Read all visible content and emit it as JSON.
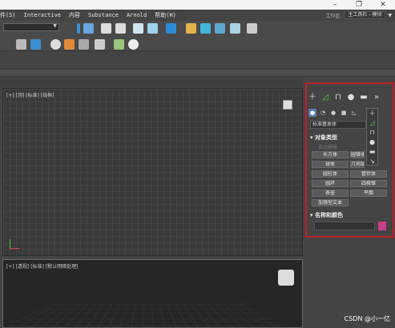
{
  "menubar": {
    "items": [
      "件(S)",
      "Interactive",
      "内容",
      "Substance",
      "Arnold",
      "帮助(H)"
    ],
    "workspace_label": "工作区:",
    "workspace_value": "主工具栏 - 模块"
  },
  "viewports": {
    "top_label": "[+] [顶] [标准] [线框]",
    "bottom_label": "[+] [透视] [标准] [默认明暗处理]"
  },
  "command_panel": {
    "category_dropdown": "标准基本体",
    "object_type_heading": "对象类型",
    "autogrid_label": "自动栅格",
    "object_buttons": [
      "长方体",
      "圆锥体",
      "球体",
      "几何球体",
      "圆柱体",
      "管状体",
      "圆环",
      "四棱锥",
      "茶壶",
      "平面",
      "加强型文本"
    ],
    "name_color_heading": "名称和颜色"
  },
  "colors": {
    "highlight_border": "#c0202a",
    "object_color_swatch": "#c8408a"
  },
  "watermark": "CSDN @小一亿"
}
